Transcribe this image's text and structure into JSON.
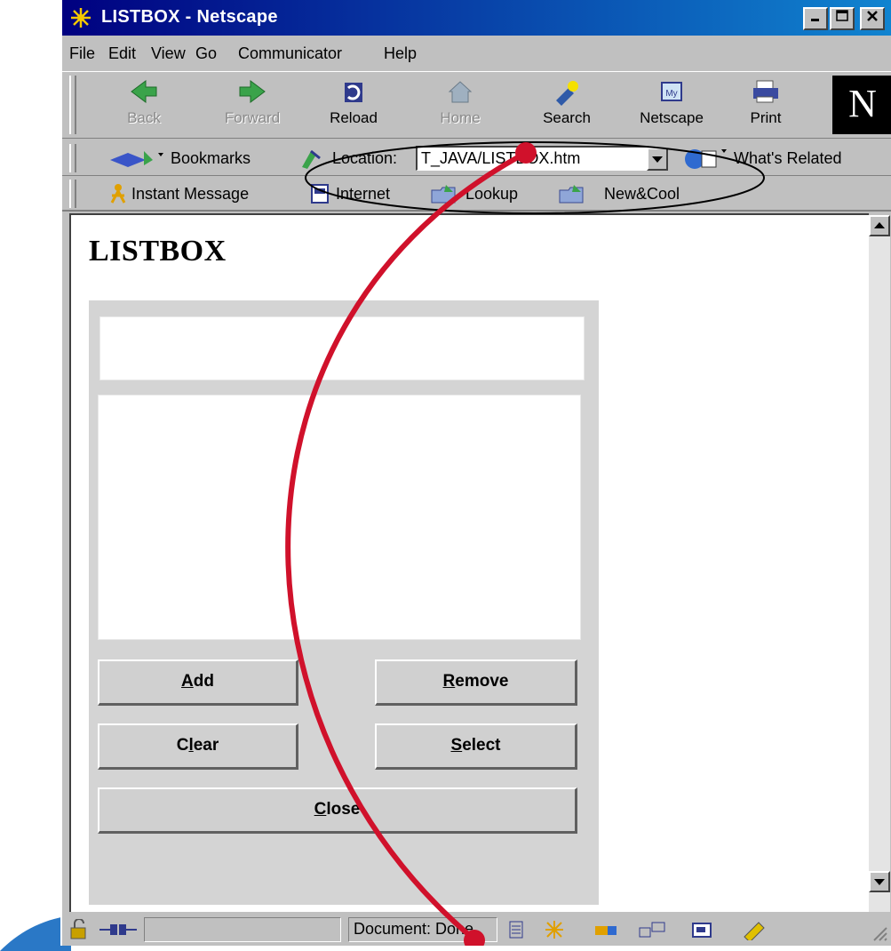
{
  "window": {
    "title": "LISTBOX - Netscape"
  },
  "menu": [
    "File",
    "Edit",
    "View",
    "Go",
    "Communicator",
    "Help"
  ],
  "toolbar": {
    "back": "Back",
    "forward": "Forward",
    "reload": "Reload",
    "home": "Home",
    "search": "Search",
    "netscape": "Netscape",
    "print": "Print",
    "logo": "N"
  },
  "location_bar": {
    "bookmarks": "Bookmarks",
    "label": "Location:",
    "url": "T_JAVA/LISTBOX.htm",
    "whats_related": "What's Related"
  },
  "personal_toolbar": [
    "Instant Message",
    "Internet",
    "Lookup",
    "New&Cool"
  ],
  "page": {
    "heading": "LISTBOX",
    "text_field": "",
    "buttons": {
      "add": "Add",
      "remove": "Remove",
      "clear": "Clear",
      "select": "Select",
      "close": "Close"
    }
  },
  "status": {
    "text": "Document: Done"
  },
  "colors": {
    "title_gradient_start": "#000080",
    "title_gradient_end": "#1084d0",
    "chrome": "#c0c0c0",
    "panel": "#d4d4d4",
    "annotation_red": "#d0112b"
  }
}
